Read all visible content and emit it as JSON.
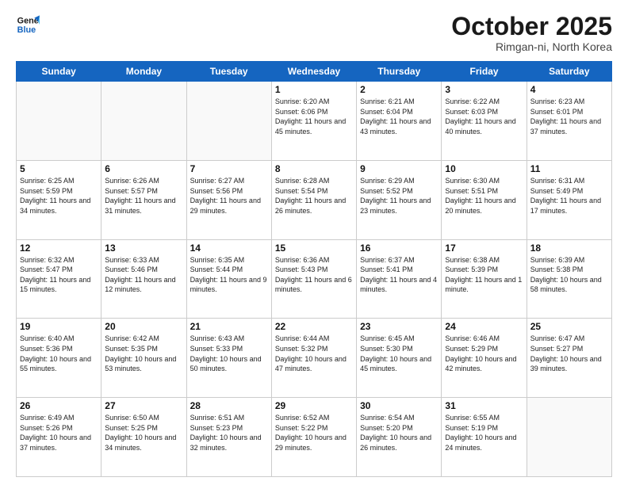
{
  "logo": {
    "line1": "General",
    "line2": "Blue"
  },
  "title": "October 2025",
  "location": "Rimgan-ni, North Korea",
  "days_of_week": [
    "Sunday",
    "Monday",
    "Tuesday",
    "Wednesday",
    "Thursday",
    "Friday",
    "Saturday"
  ],
  "weeks": [
    [
      {
        "day": "",
        "text": ""
      },
      {
        "day": "",
        "text": ""
      },
      {
        "day": "",
        "text": ""
      },
      {
        "day": "1",
        "text": "Sunrise: 6:20 AM\nSunset: 6:06 PM\nDaylight: 11 hours\nand 45 minutes."
      },
      {
        "day": "2",
        "text": "Sunrise: 6:21 AM\nSunset: 6:04 PM\nDaylight: 11 hours\nand 43 minutes."
      },
      {
        "day": "3",
        "text": "Sunrise: 6:22 AM\nSunset: 6:03 PM\nDaylight: 11 hours\nand 40 minutes."
      },
      {
        "day": "4",
        "text": "Sunrise: 6:23 AM\nSunset: 6:01 PM\nDaylight: 11 hours\nand 37 minutes."
      }
    ],
    [
      {
        "day": "5",
        "text": "Sunrise: 6:25 AM\nSunset: 5:59 PM\nDaylight: 11 hours\nand 34 minutes."
      },
      {
        "day": "6",
        "text": "Sunrise: 6:26 AM\nSunset: 5:57 PM\nDaylight: 11 hours\nand 31 minutes."
      },
      {
        "day": "7",
        "text": "Sunrise: 6:27 AM\nSunset: 5:56 PM\nDaylight: 11 hours\nand 29 minutes."
      },
      {
        "day": "8",
        "text": "Sunrise: 6:28 AM\nSunset: 5:54 PM\nDaylight: 11 hours\nand 26 minutes."
      },
      {
        "day": "9",
        "text": "Sunrise: 6:29 AM\nSunset: 5:52 PM\nDaylight: 11 hours\nand 23 minutes."
      },
      {
        "day": "10",
        "text": "Sunrise: 6:30 AM\nSunset: 5:51 PM\nDaylight: 11 hours\nand 20 minutes."
      },
      {
        "day": "11",
        "text": "Sunrise: 6:31 AM\nSunset: 5:49 PM\nDaylight: 11 hours\nand 17 minutes."
      }
    ],
    [
      {
        "day": "12",
        "text": "Sunrise: 6:32 AM\nSunset: 5:47 PM\nDaylight: 11 hours\nand 15 minutes."
      },
      {
        "day": "13",
        "text": "Sunrise: 6:33 AM\nSunset: 5:46 PM\nDaylight: 11 hours\nand 12 minutes."
      },
      {
        "day": "14",
        "text": "Sunrise: 6:35 AM\nSunset: 5:44 PM\nDaylight: 11 hours\nand 9 minutes."
      },
      {
        "day": "15",
        "text": "Sunrise: 6:36 AM\nSunset: 5:43 PM\nDaylight: 11 hours\nand 6 minutes."
      },
      {
        "day": "16",
        "text": "Sunrise: 6:37 AM\nSunset: 5:41 PM\nDaylight: 11 hours\nand 4 minutes."
      },
      {
        "day": "17",
        "text": "Sunrise: 6:38 AM\nSunset: 5:39 PM\nDaylight: 11 hours\nand 1 minute."
      },
      {
        "day": "18",
        "text": "Sunrise: 6:39 AM\nSunset: 5:38 PM\nDaylight: 10 hours\nand 58 minutes."
      }
    ],
    [
      {
        "day": "19",
        "text": "Sunrise: 6:40 AM\nSunset: 5:36 PM\nDaylight: 10 hours\nand 55 minutes."
      },
      {
        "day": "20",
        "text": "Sunrise: 6:42 AM\nSunset: 5:35 PM\nDaylight: 10 hours\nand 53 minutes."
      },
      {
        "day": "21",
        "text": "Sunrise: 6:43 AM\nSunset: 5:33 PM\nDaylight: 10 hours\nand 50 minutes."
      },
      {
        "day": "22",
        "text": "Sunrise: 6:44 AM\nSunset: 5:32 PM\nDaylight: 10 hours\nand 47 minutes."
      },
      {
        "day": "23",
        "text": "Sunrise: 6:45 AM\nSunset: 5:30 PM\nDaylight: 10 hours\nand 45 minutes."
      },
      {
        "day": "24",
        "text": "Sunrise: 6:46 AM\nSunset: 5:29 PM\nDaylight: 10 hours\nand 42 minutes."
      },
      {
        "day": "25",
        "text": "Sunrise: 6:47 AM\nSunset: 5:27 PM\nDaylight: 10 hours\nand 39 minutes."
      }
    ],
    [
      {
        "day": "26",
        "text": "Sunrise: 6:49 AM\nSunset: 5:26 PM\nDaylight: 10 hours\nand 37 minutes."
      },
      {
        "day": "27",
        "text": "Sunrise: 6:50 AM\nSunset: 5:25 PM\nDaylight: 10 hours\nand 34 minutes."
      },
      {
        "day": "28",
        "text": "Sunrise: 6:51 AM\nSunset: 5:23 PM\nDaylight: 10 hours\nand 32 minutes."
      },
      {
        "day": "29",
        "text": "Sunrise: 6:52 AM\nSunset: 5:22 PM\nDaylight: 10 hours\nand 29 minutes."
      },
      {
        "day": "30",
        "text": "Sunrise: 6:54 AM\nSunset: 5:20 PM\nDaylight: 10 hours\nand 26 minutes."
      },
      {
        "day": "31",
        "text": "Sunrise: 6:55 AM\nSunset: 5:19 PM\nDaylight: 10 hours\nand 24 minutes."
      },
      {
        "day": "",
        "text": ""
      }
    ]
  ]
}
